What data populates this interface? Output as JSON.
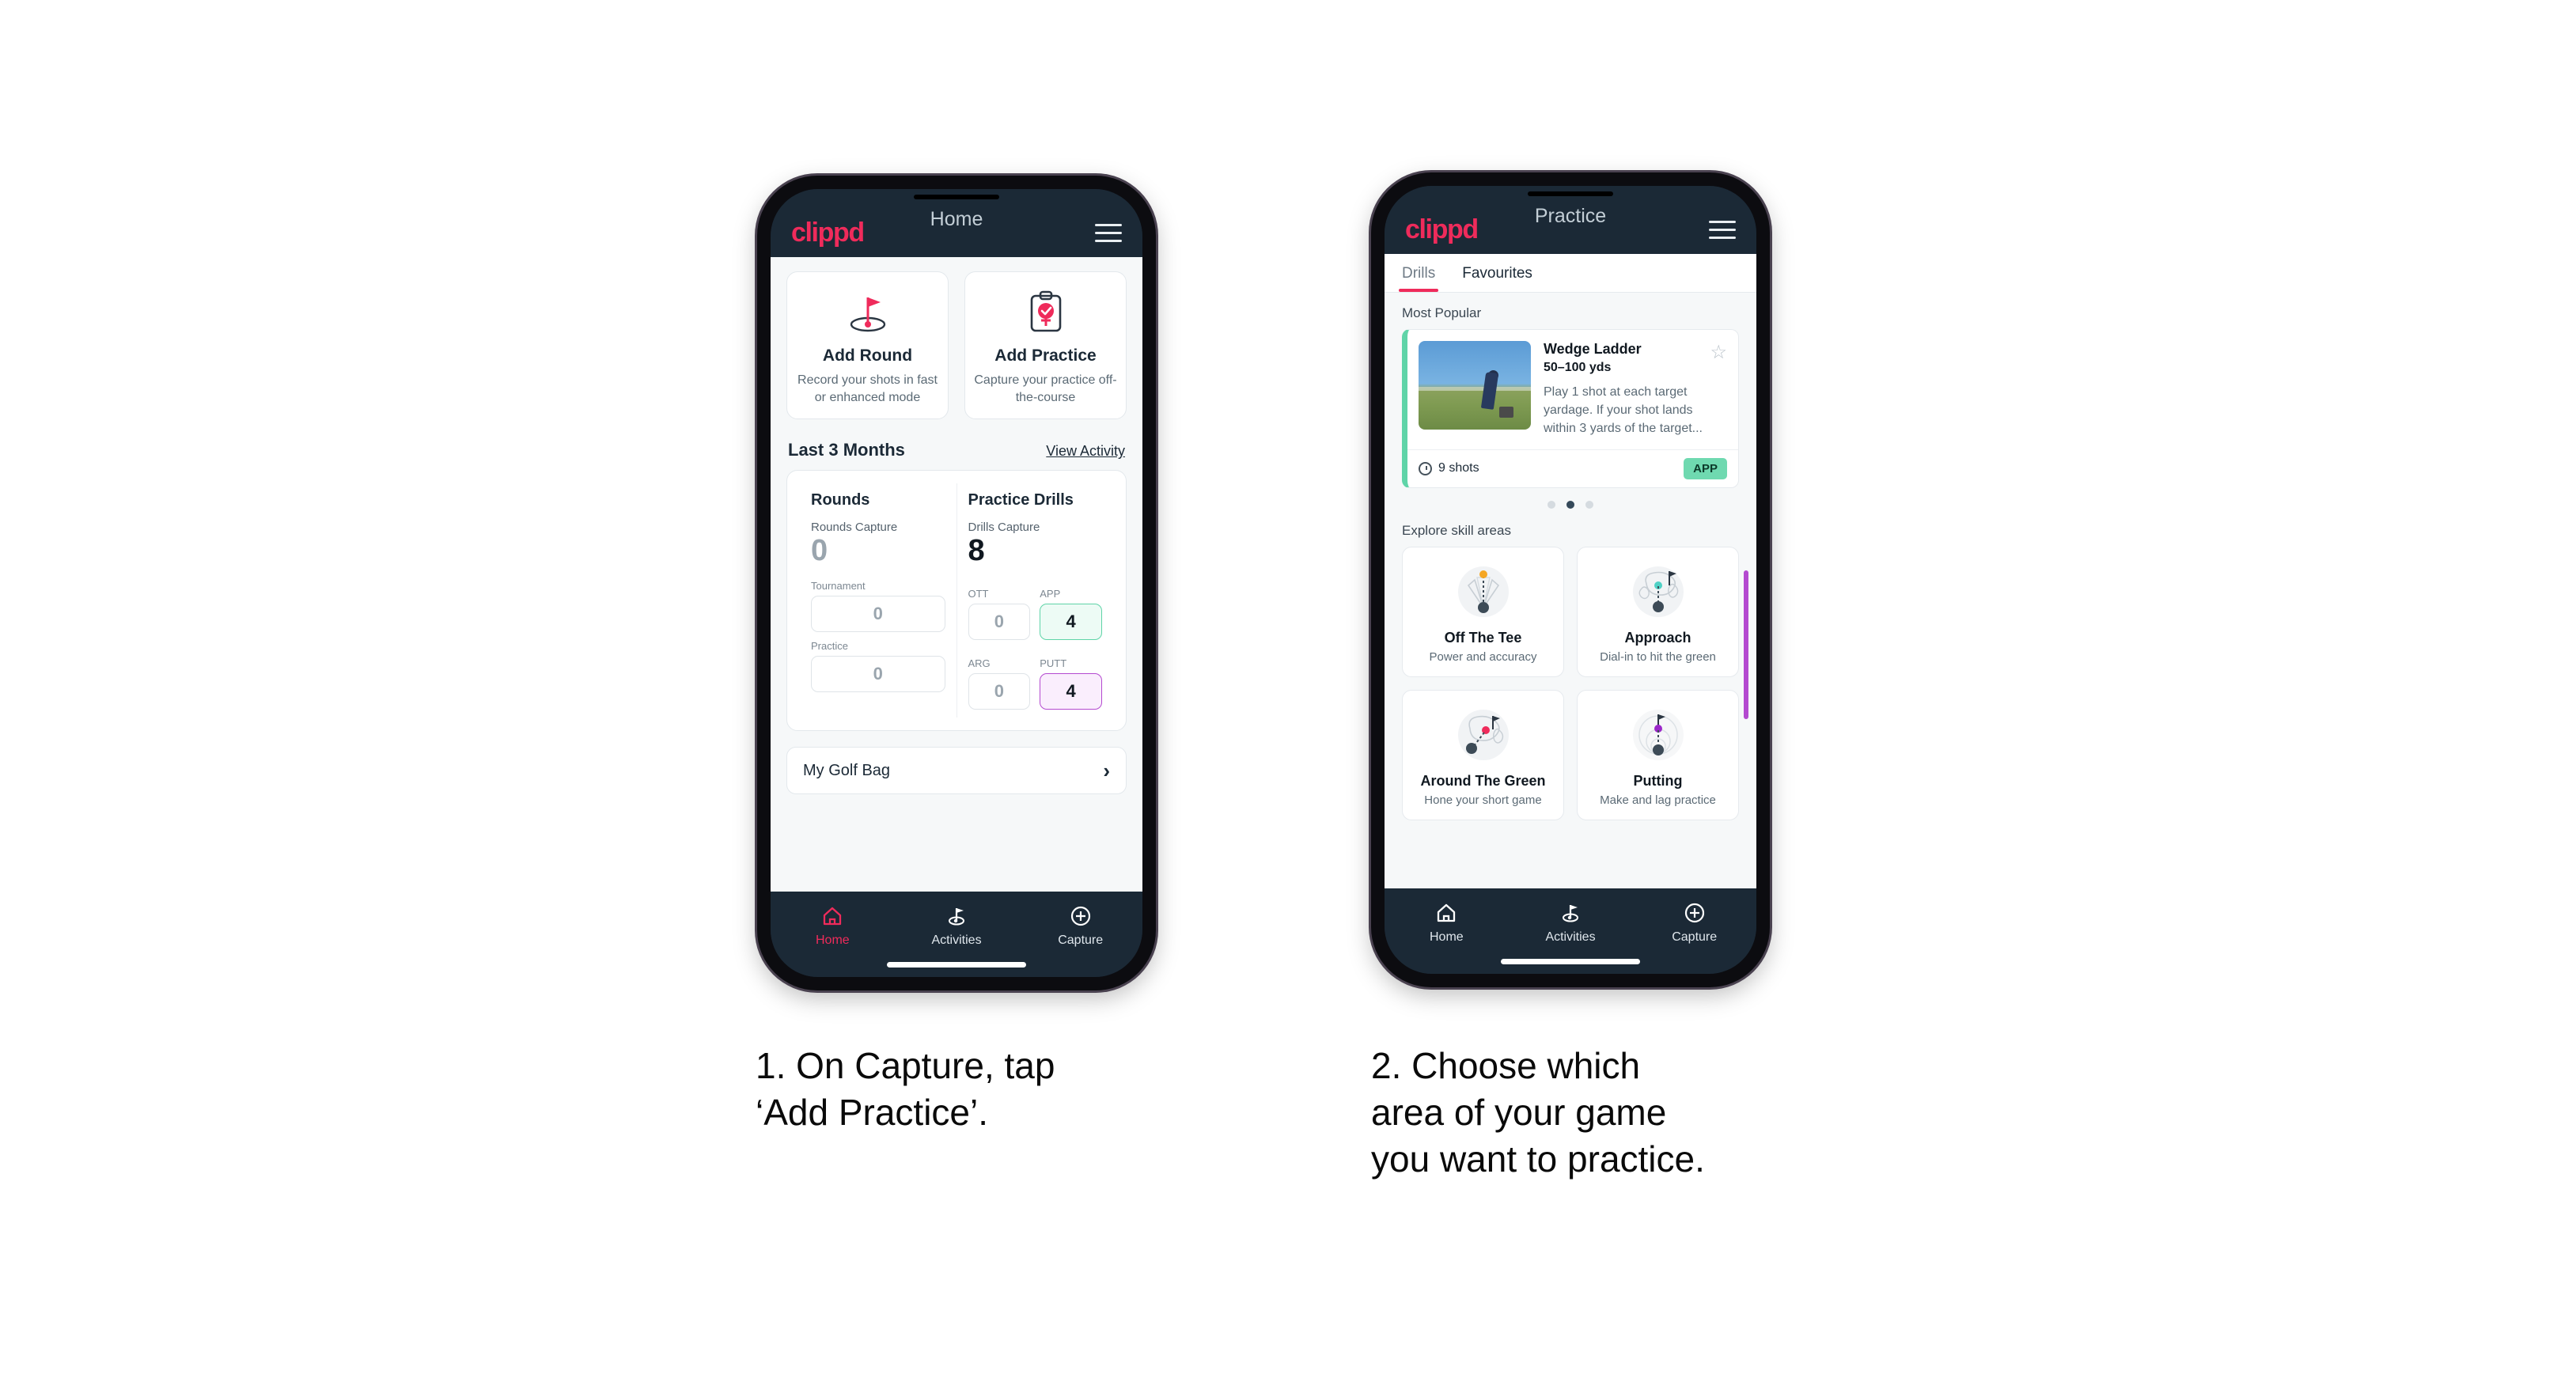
{
  "brand": "clippd",
  "phone_home": {
    "header": {
      "title": "Home",
      "menu_icon": "hamburger-icon"
    },
    "quick_actions": [
      {
        "icon": "golf-flag-hole-icon",
        "title": "Add Round",
        "subtitle": "Record your shots in fast or enhanced mode"
      },
      {
        "icon": "clipboard-check-icon",
        "title": "Add Practice",
        "subtitle": "Capture your practice off-the-course"
      }
    ],
    "section": {
      "title": "Last 3 Months",
      "link": "View Activity"
    },
    "stats": {
      "rounds": {
        "title": "Rounds",
        "capture_label": "Rounds Capture",
        "capture_value": "0",
        "cells": [
          {
            "label": "Tournament",
            "value": "0",
            "accent": "none"
          },
          {
            "label": "Practice",
            "value": "0",
            "accent": "none"
          }
        ]
      },
      "drills": {
        "title": "Practice Drills",
        "capture_label": "Drills Capture",
        "capture_value": "8",
        "cells": [
          {
            "label": "OTT",
            "value": "0",
            "accent": "none"
          },
          {
            "label": "APP",
            "value": "4",
            "accent": "green"
          },
          {
            "label": "ARG",
            "value": "0",
            "accent": "none"
          },
          {
            "label": "PUTT",
            "value": "4",
            "accent": "purple"
          }
        ]
      }
    },
    "golf_bag": {
      "label": "My Golf Bag",
      "chevron": "chevron-right-icon"
    },
    "bottom_nav": [
      {
        "icon": "home-icon",
        "label": "Home",
        "active": true
      },
      {
        "icon": "golf-flag-icon",
        "label": "Activities",
        "active": false
      },
      {
        "icon": "plus-circle-icon",
        "label": "Capture",
        "active": false
      }
    ]
  },
  "phone_practice": {
    "header": {
      "title": "Practice",
      "menu_icon": "hamburger-icon"
    },
    "tabs": [
      {
        "label": "Drills",
        "active": true
      },
      {
        "label": "Favourites",
        "active": false
      }
    ],
    "most_popular_label": "Most Popular",
    "drill": {
      "title": "Wedge Ladder",
      "yardage": "50–100 yds",
      "description": "Play 1 shot at each target yardage. If your shot lands within 3 yards of the target...",
      "shots": "9 shots",
      "badge": "APP",
      "star_icon": "star-outline-icon",
      "clock_icon": "clock-icon",
      "accent_color": "#5fd4a8",
      "next_accent_color": "#b44ad0"
    },
    "carousel_dots": [
      false,
      true,
      false
    ],
    "explore_label": "Explore skill areas",
    "skill_areas": [
      {
        "icon": "off-the-tee-icon",
        "name": "Off The Tee",
        "subtitle": "Power and accuracy",
        "dot_color": "#f5a623"
      },
      {
        "icon": "approach-icon",
        "name": "Approach",
        "subtitle": "Dial-in to hit the green",
        "dot_color": "#4fd1c5"
      },
      {
        "icon": "around-the-green-icon",
        "name": "Around The Green",
        "subtitle": "Hone your short game",
        "dot_color": "#ef2b5b"
      },
      {
        "icon": "putting-icon",
        "name": "Putting",
        "subtitle": "Make and lag practice",
        "dot_color": "#9b27c9"
      }
    ],
    "bottom_nav": [
      {
        "icon": "home-icon",
        "label": "Home",
        "active": false
      },
      {
        "icon": "golf-flag-icon",
        "label": "Activities",
        "active": false
      },
      {
        "icon": "plus-circle-icon",
        "label": "Capture",
        "active": false
      }
    ]
  },
  "captions": {
    "step1": "1. On Capture, tap\n‘Add Practice’.",
    "step2": "2. Choose which\narea of your game\nyou want to practice."
  },
  "colors": {
    "brand_pink": "#ef2b5b",
    "dark_navy": "#1b2936",
    "mint": "#5fd4a8",
    "purple": "#b44ad0",
    "screen_bg": "#f6f8f9"
  }
}
